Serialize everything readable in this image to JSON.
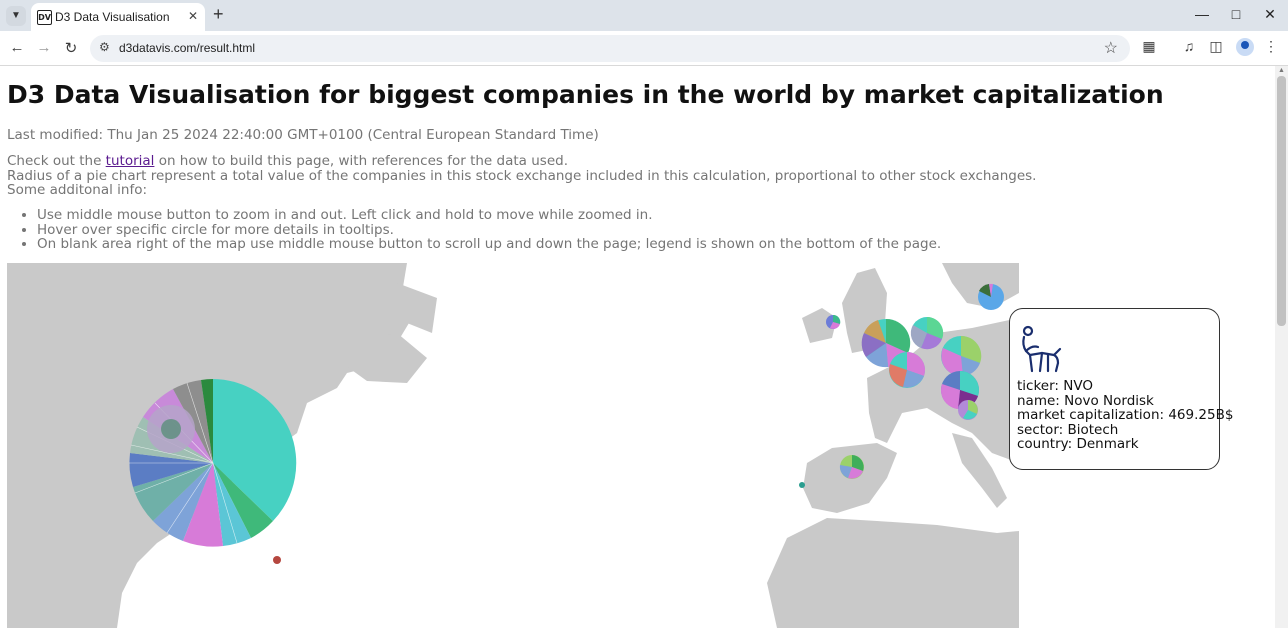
{
  "browser": {
    "tab_title": "D3 Data Visualisation",
    "favicon_text": "DV",
    "url": "d3datavis.com/result.html"
  },
  "page": {
    "title": "D3 Data Visualisation for biggest companies in the world by market capitalization",
    "last_modified": "Last modified: Thu Jan 25 2024 22:40:00 GMT+0100 (Central European Standard Time)",
    "intro_before_link": "Check out the ",
    "link_text": "tutorial",
    "intro_after_link": " on how to build this page, with references for the data used.",
    "radius_note": "Radius of a pie chart represent a total value of the companies in this stock exchange included in this calculation, proportional to other stock exchanges.",
    "additional_heading": "Some additonal info:",
    "tips": [
      "Use middle mouse button to zoom in and out. Left click and hold to move while zoomed in.",
      "Hover over specific circle for more details in tooltips.",
      "On blank area right of the map use middle mouse button to scroll up and down the page; legend is shown on the bottom of the page."
    ]
  },
  "tooltip": {
    "ticker": "ticker: NVO",
    "name": "name: Novo Nordisk",
    "market_cap": "market capitalization: 469.25B$",
    "sector": "sector: Biotech",
    "country": "country: Denmark"
  },
  "colors": {
    "land": "#c9c9c9",
    "link": "#5a1a8f",
    "pie_main": "#47d1c2"
  }
}
